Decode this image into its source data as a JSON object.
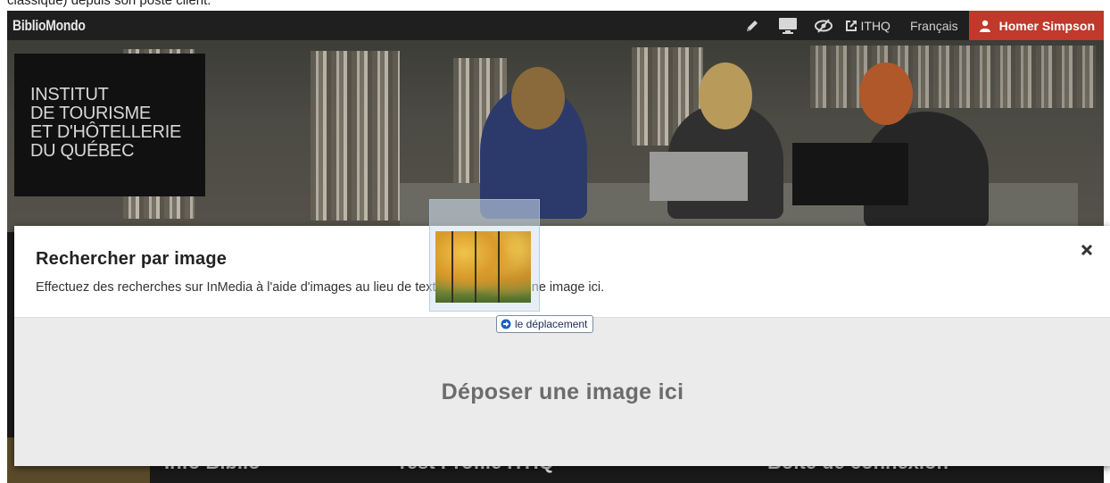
{
  "page": {
    "caption": "classique) depuis son poste client."
  },
  "navbar": {
    "brand": "BiblioMondo",
    "icons": [
      "pencil-icon",
      "monitor-icon",
      "eye-slash-icon"
    ],
    "ithq_link": "ITHQ",
    "language": "Français",
    "user_name": "Homer Simpson",
    "colors": {
      "bar": "#1f1f1f",
      "user_button": "#c0392b"
    }
  },
  "hero": {
    "logo_lines": [
      "INSTITUT",
      "DE TOURISME",
      "ET D'HÔTELLERIE",
      "DU QUÉBEC"
    ]
  },
  "background_sections": [
    "Info Biblio",
    "Test Profile ITHQ",
    "Boîte de connexion"
  ],
  "modal": {
    "title": "Rechercher par image",
    "subtitle": "Effectuez des recherches sur InMedia à l'aide d'images au lieu de texte. Faire glisser une image ici.",
    "drop_label": "Déposer une image ici"
  },
  "drag": {
    "tooltip": "le déplacement"
  }
}
